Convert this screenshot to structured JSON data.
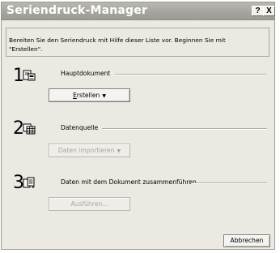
{
  "window": {
    "title": "Seriendruck-Manager",
    "help_label": "?",
    "close_label": "X"
  },
  "intro": {
    "text": "Bereiten Sie den Seriendruck mit Hilfe dieser Liste vor. Beginnen Sie mit\n\"Erstellen\"."
  },
  "steps": [
    {
      "number": "1",
      "label": "Hauptdokument",
      "button": {
        "label_underlined": "E",
        "label_rest": "rstellen",
        "arrow": "▼",
        "enabled": true
      },
      "icon": "main-document-icon"
    },
    {
      "number": "2",
      "label": "Datenquelle",
      "button": {
        "label": "Daten importieren",
        "arrow": "▼",
        "enabled": false
      },
      "icon": "data-source-icon"
    },
    {
      "number": "3",
      "label": "Daten mit dem Dokument zusammenführen",
      "button": {
        "label": "Ausführen...",
        "enabled": false
      },
      "icon": "merge-icon"
    }
  ],
  "footer": {
    "cancel_label": "Abbrechen"
  }
}
